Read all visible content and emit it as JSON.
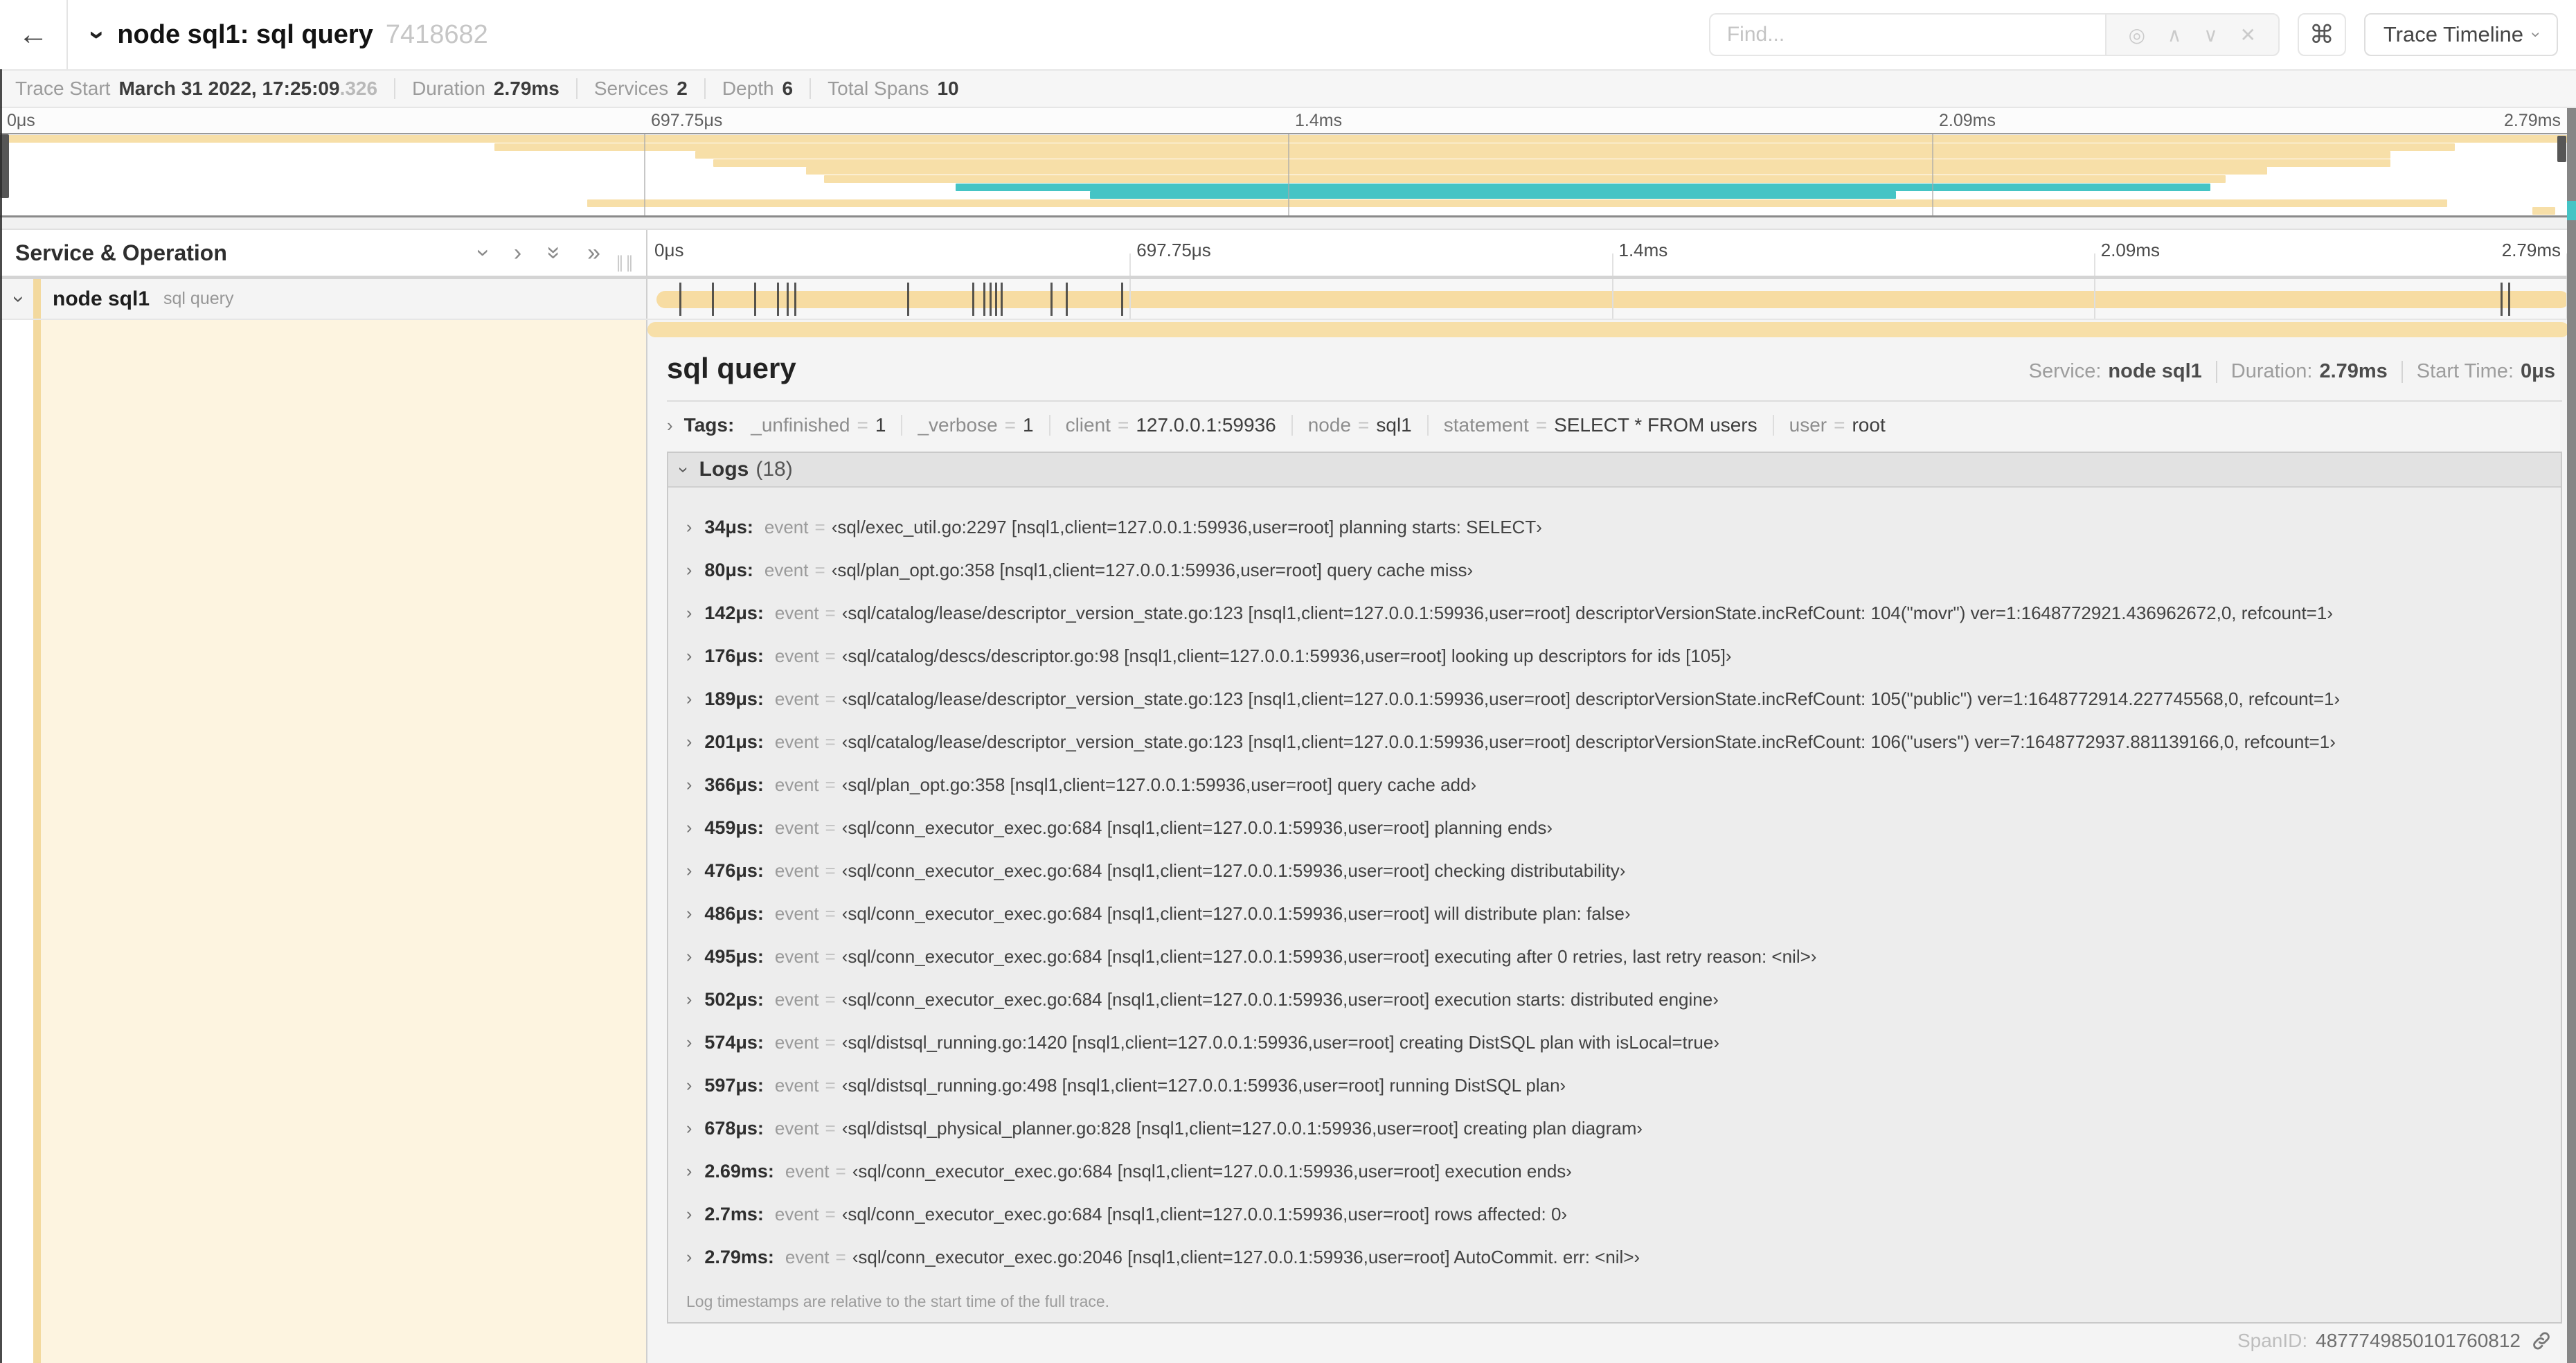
{
  "icons": {
    "back": "←",
    "command": "⌘",
    "chevron": "›",
    "double_chevron": "»",
    "find_target": "◎",
    "find_up": "∧",
    "find_down": "∨",
    "find_close": "✕",
    "drag_handle": "∥∥"
  },
  "header": {
    "title": "node sql1: sql query",
    "trace_id_short": "7418682",
    "find_placeholder": "Find...",
    "view_selector_label": "Trace Timeline"
  },
  "trace_info": [
    {
      "label": "Trace Start",
      "value": "March 31 2022, 17:25:09",
      "suffix": ".326"
    },
    {
      "label": "Duration",
      "value": "2.79ms"
    },
    {
      "label": "Services",
      "value": "2"
    },
    {
      "label": "Depth",
      "value": "6"
    },
    {
      "label": "Total Spans",
      "value": "10"
    }
  ],
  "timeline": {
    "ticks": [
      "0μs",
      "697.75μs",
      "1.4ms",
      "2.09ms",
      "2.79ms"
    ],
    "left_header": "Service & Operation"
  },
  "colors": {
    "span_tan": "#f7dfa8",
    "span_bar": "#f7dca2",
    "teal": "#45c4c5",
    "cream": "#fdf4e0"
  },
  "minimap_spans": [
    {
      "left": 0.0,
      "width": 99.7,
      "color": "#f7dfa8"
    },
    {
      "left": 19.2,
      "width": 76.1,
      "color": "#f7dfa8"
    },
    {
      "left": 27.0,
      "width": 65.8,
      "color": "#f7dfa8"
    },
    {
      "left": 27.7,
      "width": 65.1,
      "color": "#f7dfa8"
    },
    {
      "left": 31.3,
      "width": 56.7,
      "color": "#f7dfa8"
    },
    {
      "left": 32.0,
      "width": 54.4,
      "color": "#f7dfa8"
    },
    {
      "left": 37.1,
      "width": 48.7,
      "color": "#45c4c5"
    },
    {
      "left": 42.3,
      "width": 31.3,
      "color": "#45c4c5"
    },
    {
      "left": 22.8,
      "width": 72.2,
      "color": "#f7dfa8"
    },
    {
      "left": 98.3,
      "width": 0.9,
      "color": "#f7dfa8"
    }
  ],
  "span_row": {
    "service": "node sql1",
    "operation": "sql query",
    "marker_pcts": [
      1.2,
      2.9,
      5.1,
      6.3,
      6.8,
      7.2,
      13.1,
      16.5,
      17.1,
      17.4,
      17.7,
      18.0,
      20.6,
      21.4,
      24.3,
      96.4,
      96.8,
      99.9
    ]
  },
  "detail": {
    "title": "sql query",
    "meta": [
      {
        "label": "Service:",
        "value": "node sql1"
      },
      {
        "label": "Duration:",
        "value": "2.79ms"
      },
      {
        "label": "Start Time:",
        "value": "0μs"
      }
    ],
    "tags_label": "Tags:",
    "tags": [
      {
        "key": "_unfinished",
        "value": "1"
      },
      {
        "key": "_verbose",
        "value": "1"
      },
      {
        "key": "client",
        "value": "127.0.0.1:59936"
      },
      {
        "key": "node",
        "value": "sql1"
      },
      {
        "key": "statement",
        "value": "SELECT * FROM users"
      },
      {
        "key": "user",
        "value": "root"
      }
    ],
    "logs_label": "Logs",
    "logs_count": "(18)",
    "log_key": "event",
    "logs": [
      {
        "time": "34μs:",
        "value": "‹sql/exec_util.go:2297 [nsql1,client=127.0.0.1:59936,user=root] planning starts: SELECT›"
      },
      {
        "time": "80μs:",
        "value": "‹sql/plan_opt.go:358 [nsql1,client=127.0.0.1:59936,user=root] query cache miss›"
      },
      {
        "time": "142μs:",
        "value": "‹sql/catalog/lease/descriptor_version_state.go:123 [nsql1,client=127.0.0.1:59936,user=root] descriptorVersionState.incRefCount: 104(\"movr\") ver=1:1648772921.436962672,0, refcount=1›"
      },
      {
        "time": "176μs:",
        "value": "‹sql/catalog/descs/descriptor.go:98 [nsql1,client=127.0.0.1:59936,user=root] looking up descriptors for ids [105]›"
      },
      {
        "time": "189μs:",
        "value": "‹sql/catalog/lease/descriptor_version_state.go:123 [nsql1,client=127.0.0.1:59936,user=root] descriptorVersionState.incRefCount: 105(\"public\") ver=1:1648772914.227745568,0, refcount=1›"
      },
      {
        "time": "201μs:",
        "value": "‹sql/catalog/lease/descriptor_version_state.go:123 [nsql1,client=127.0.0.1:59936,user=root] descriptorVersionState.incRefCount: 106(\"users\") ver=7:1648772937.881139166,0, refcount=1›"
      },
      {
        "time": "366μs:",
        "value": "‹sql/plan_opt.go:358 [nsql1,client=127.0.0.1:59936,user=root] query cache add›"
      },
      {
        "time": "459μs:",
        "value": "‹sql/conn_executor_exec.go:684 [nsql1,client=127.0.0.1:59936,user=root] planning ends›"
      },
      {
        "time": "476μs:",
        "value": "‹sql/conn_executor_exec.go:684 [nsql1,client=127.0.0.1:59936,user=root] checking distributability›"
      },
      {
        "time": "486μs:",
        "value": "‹sql/conn_executor_exec.go:684 [nsql1,client=127.0.0.1:59936,user=root] will distribute plan: false›"
      },
      {
        "time": "495μs:",
        "value": "‹sql/conn_executor_exec.go:684 [nsql1,client=127.0.0.1:59936,user=root] executing after 0 retries, last retry reason: <nil>›"
      },
      {
        "time": "502μs:",
        "value": "‹sql/conn_executor_exec.go:684 [nsql1,client=127.0.0.1:59936,user=root] execution starts: distributed engine›"
      },
      {
        "time": "574μs:",
        "value": "‹sql/distsql_running.go:1420 [nsql1,client=127.0.0.1:59936,user=root] creating DistSQL plan with isLocal=true›"
      },
      {
        "time": "597μs:",
        "value": "‹sql/distsql_running.go:498 [nsql1,client=127.0.0.1:59936,user=root] running DistSQL plan›"
      },
      {
        "time": "678μs:",
        "value": "‹sql/distsql_physical_planner.go:828 [nsql1,client=127.0.0.1:59936,user=root] creating plan diagram›"
      },
      {
        "time": "2.69ms:",
        "value": "‹sql/conn_executor_exec.go:684 [nsql1,client=127.0.0.1:59936,user=root] execution ends›"
      },
      {
        "time": "2.7ms:",
        "value": "‹sql/conn_executor_exec.go:684 [nsql1,client=127.0.0.1:59936,user=root] rows affected: 0›"
      },
      {
        "time": "2.79ms:",
        "value": "‹sql/conn_executor_exec.go:2046 [nsql1,client=127.0.0.1:59936,user=root] AutoCommit. err: <nil>›"
      }
    ],
    "logs_footnote": "Log timestamps are relative to the start time of the full trace.",
    "span_id_label": "SpanID:",
    "span_id": "4877749850101760812"
  }
}
